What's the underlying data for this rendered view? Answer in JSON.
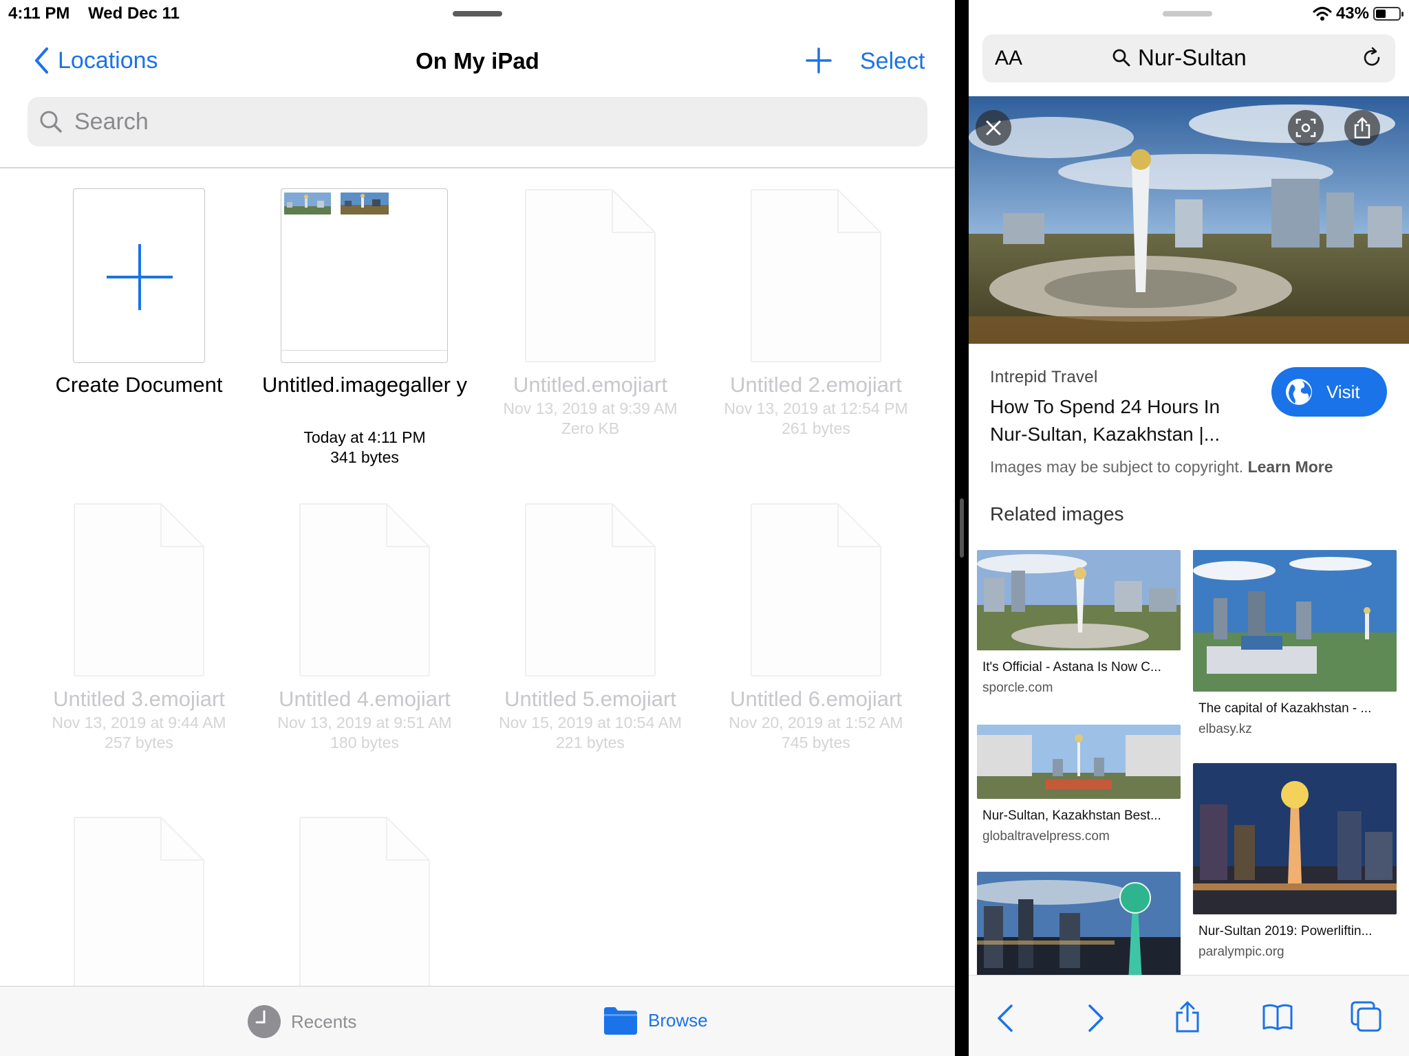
{
  "status": {
    "time": "4:11 PM",
    "date": "Wed Dec 11",
    "battery": "43%"
  },
  "files": {
    "back_label": "Locations",
    "title": "On My iPad",
    "select_label": "Select",
    "search_placeholder": "Search",
    "items": [
      {
        "name": "Create Document"
      },
      {
        "name": "Untitled.imagegaller y",
        "date": "Today at 4:11 PM",
        "size": "341 bytes"
      },
      {
        "name": "Untitled.emojiart",
        "date": "Nov 13, 2019 at 9:39 AM",
        "size": "Zero KB"
      },
      {
        "name": "Untitled 2.emojiart",
        "date": "Nov 13, 2019 at 12:54 PM",
        "size": "261 bytes"
      },
      {
        "name": "Untitled 3.emojiart",
        "date": "Nov 13, 2019 at 9:44 AM",
        "size": "257 bytes"
      },
      {
        "name": "Untitled 4.emojiart",
        "date": "Nov 13, 2019 at 9:51 AM",
        "size": "180 bytes"
      },
      {
        "name": "Untitled 5.emojiart",
        "date": "Nov 15, 2019 at 10:54 AM",
        "size": "221 bytes"
      },
      {
        "name": "Untitled 6.emojiart",
        "date": "Nov 20, 2019 at 1:52 AM",
        "size": "745 bytes"
      }
    ],
    "tabs": {
      "recents": "Recents",
      "browse": "Browse"
    },
    "colors": {
      "accent": "#1a73e8"
    }
  },
  "safari": {
    "text_size_label": "AA",
    "search_query": "Nur-Sultan",
    "result": {
      "source": "Intrepid Travel",
      "title": "How To Spend 24 Hours In Nur-Sultan, Kazakhstan |...",
      "visit_label": "Visit",
      "copyright": "Images may be subject to copyright.",
      "learn_more": "Learn More"
    },
    "related_heading": "Related images",
    "related": [
      {
        "caption": "It's Official - Astana Is Now C...",
        "domain": "sporcle.com"
      },
      {
        "caption": "The capital of Kazakhstan - ...",
        "domain": "elbasy.kz"
      },
      {
        "caption": "Nur-Sultan, Kazakhstan Best...",
        "domain": "globaltravelpress.com"
      },
      {
        "caption": "Nur-Sultan 2019: Powerliftin...",
        "domain": "paralympic.org"
      }
    ]
  }
}
